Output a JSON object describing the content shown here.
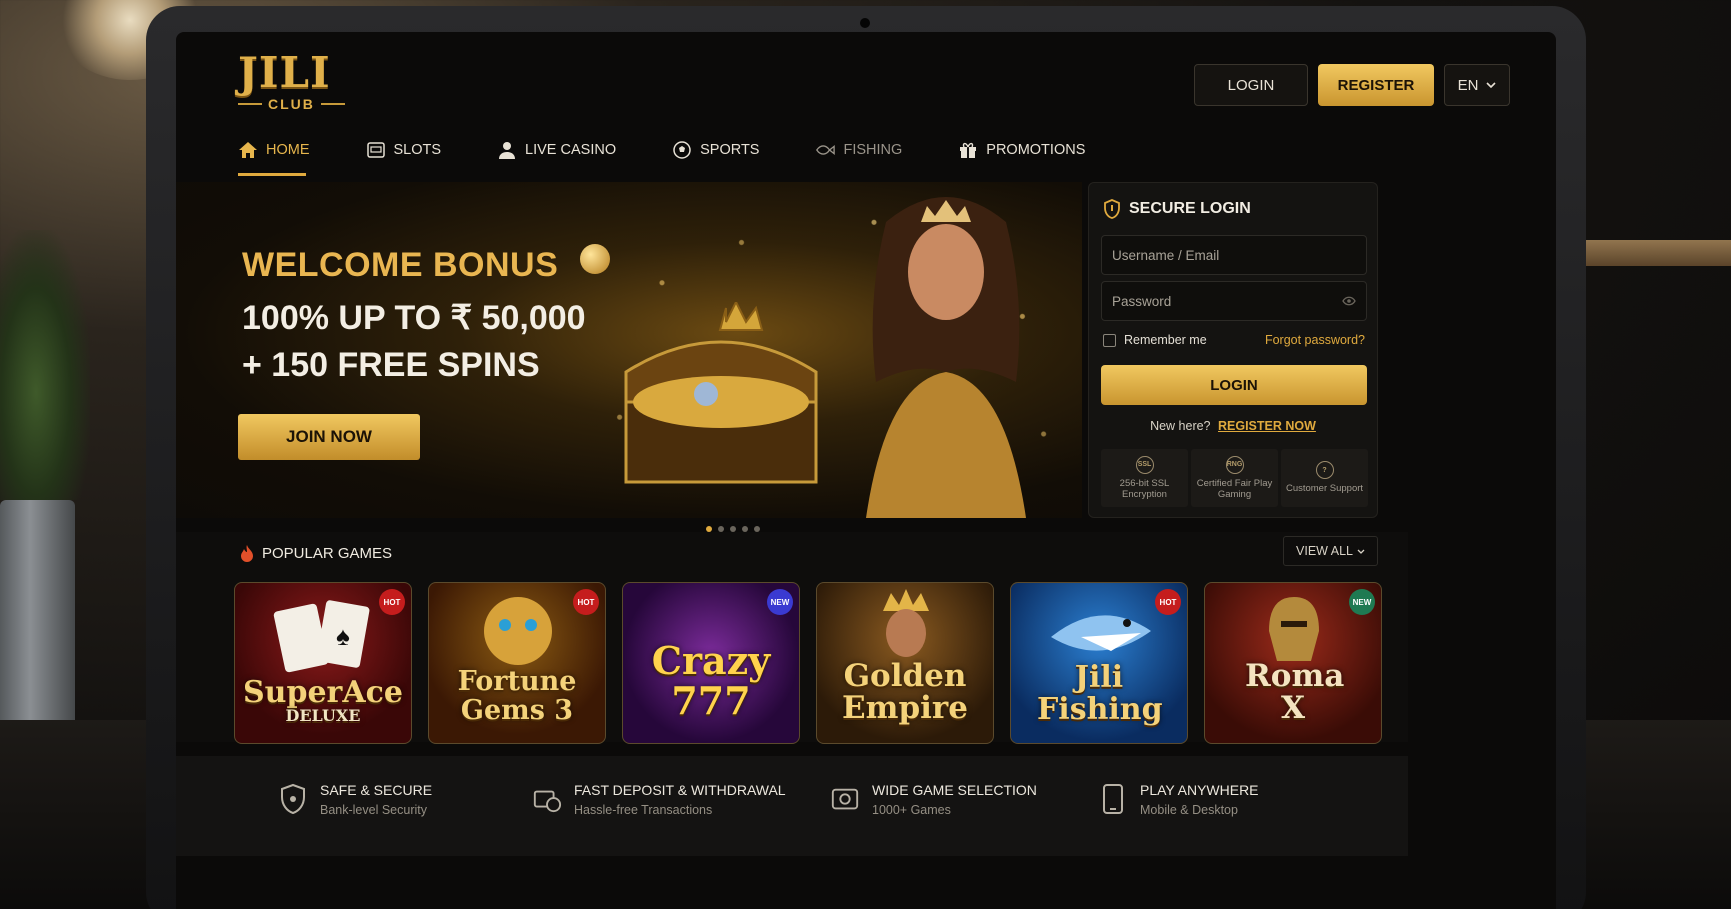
{
  "brand": {
    "logo_main": "JILI",
    "logo_sub": "CLUB",
    "accent": "#e0aa3e"
  },
  "header": {
    "login_label": "LOGIN",
    "register_label": "REGISTER",
    "language": "EN"
  },
  "nav": {
    "items": [
      {
        "label": "HOME",
        "icon": "home-icon",
        "active": true
      },
      {
        "label": "SLOTS",
        "icon": "slot-machine-icon"
      },
      {
        "label": "LIVE CASINO",
        "icon": "dealer-icon"
      },
      {
        "label": "SPORTS",
        "icon": "soccer-ball-icon"
      },
      {
        "label": "FISHING",
        "icon": "fish-icon"
      },
      {
        "label": "PROMOTIONS",
        "icon": "gift-icon"
      }
    ]
  },
  "hero": {
    "title": "WELCOME BONUS",
    "line2": "100% UP TO ₹ 50,000",
    "line3": "+ 150 FREE SPINS",
    "cta": "JOIN NOW",
    "slides": 5,
    "active_slide": 1
  },
  "login_panel": {
    "title": "SECURE LOGIN",
    "username_placeholder": "Username / Email",
    "password_placeholder": "Password",
    "remember": "Remember me",
    "forgot": "Forgot password?",
    "login_button": "LOGIN",
    "new_here": "New here?",
    "register_now": "REGISTER NOW",
    "badges": [
      {
        "icon_text": "SSL",
        "text": "256-bit SSL Encryption"
      },
      {
        "icon_text": "RNG",
        "text": "Certified Fair Play Gaming"
      },
      {
        "icon_text": "?",
        "text": "Customer Support"
      }
    ]
  },
  "popular": {
    "title": "POPULAR GAMES",
    "view_all": "VIEW ALL",
    "games": [
      {
        "title": "SuperAce",
        "subtitle": "DELUXE",
        "tag": "HOT"
      },
      {
        "title": "Fortune Gems 3",
        "subtitle": "",
        "tag": "HOT"
      },
      {
        "title": "Crazy 777",
        "subtitle": "",
        "tag": "NEW"
      },
      {
        "title": "Golden Empire",
        "subtitle": "",
        "tag": ""
      },
      {
        "title": "Jili Fishing",
        "subtitle": "",
        "tag": "HOT"
      },
      {
        "title": "Roma X",
        "subtitle": "",
        "tag": "NEW"
      }
    ]
  },
  "features": [
    {
      "title": "SAFE & SECURE",
      "sub": "Bank-level Security",
      "icon": "shield-icon"
    },
    {
      "title": "FAST DEPOSIT & WITHDRAWAL",
      "sub": "Hassle-free Transactions",
      "icon": "transfer-icon"
    },
    {
      "title": "WIDE GAME SELECTION",
      "sub": "1000+ Games",
      "icon": "games-icon"
    },
    {
      "title": "PLAY ANYWHERE",
      "sub": "Mobile & Desktop",
      "icon": "mobile-icon"
    }
  ]
}
